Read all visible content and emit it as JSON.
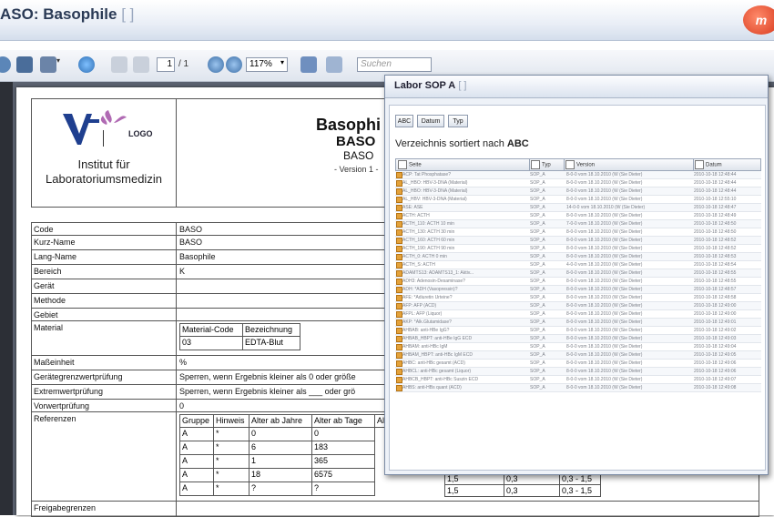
{
  "window": {
    "title": "ASO: Basophile",
    "title_suffix": "[ ]"
  },
  "toolbar": {
    "page_current": "1",
    "page_total": "/ 1",
    "zoom": "117%",
    "search_placeholder": "Suchen"
  },
  "header": {
    "logo_text": "LOGO",
    "institute_line1": "Institut für",
    "institute_line2": "Laboratoriumsmedizin",
    "doc_title": "Basophi",
    "doc_code": "BASO",
    "doc_code2": "BASO",
    "version": "- Version 1 -"
  },
  "fields": [
    {
      "key": "Code",
      "value": "BASO"
    },
    {
      "key": "Kurz-Name",
      "value": "BASO"
    },
    {
      "key": "Lang-Name",
      "value": "Basophile"
    },
    {
      "key": "Bereich",
      "value": "K"
    },
    {
      "key": "Gerät",
      "value": ""
    },
    {
      "key": "Methode",
      "value": ""
    },
    {
      "key": "Gebiet",
      "value": ""
    },
    {
      "key": "Material",
      "value": ""
    },
    {
      "key": "Maßeinheit",
      "value": "%"
    },
    {
      "key": "Gerätegrenzwertprüfung",
      "value": "Sperren, wenn Ergebnis kleiner als 0 oder größe"
    },
    {
      "key": "Extremwertprüfung",
      "value": "Sperren, wenn Ergebnis kleiner als ___ oder grö"
    },
    {
      "key": "Vorwertprüfung",
      "value": "0"
    },
    {
      "key": "Referenzen",
      "value": ""
    },
    {
      "key": "Freigabegrenzen",
      "value": ""
    }
  ],
  "material_table": {
    "headers": [
      "Material-Code",
      "Bezeichnung"
    ],
    "row": [
      "03",
      "EDTA-Blut"
    ]
  },
  "reference_table": {
    "headers": [
      "Gruppe",
      "Hinweis",
      "Alter ab Jahre",
      "Alter ab Tage",
      "Al"
    ],
    "rows": [
      [
        "A",
        "*",
        "0",
        "0",
        ""
      ],
      [
        "A",
        "*",
        "6",
        "183",
        ""
      ],
      [
        "A",
        "*",
        "1",
        "365",
        ""
      ],
      [
        "A",
        "*",
        "18",
        "6575",
        ""
      ],
      [
        "A",
        "*",
        "?",
        "?",
        ""
      ]
    ],
    "extra_rows": [
      [
        "1,5",
        "0,3",
        "0,3 - 1,5"
      ],
      [
        "1,5",
        "0,3",
        "0,3 - 1,5"
      ]
    ]
  },
  "popup": {
    "title": "Labor SOP A",
    "title_suffix": "[ ]",
    "sort_buttons": [
      "ABC",
      "Datum",
      "Typ"
    ],
    "sorted_prefix": "Verzeichnis sortiert nach",
    "sorted_key": "ABC",
    "columns": [
      "Seite",
      "Typ",
      "Version",
      "Datum"
    ],
    "rows": [
      [
        "ACP: Tat Phosphatase?",
        "SOP_A",
        "8-0-0 vom 18.10.2010 (W (Sie Dieter)",
        "2010-10-18 12:48:44"
      ],
      [
        "AL_HBO: HBV-3-DNA (Material)",
        "SOP_A",
        "8-0-0 vom 18.10.2010 (W (Sie Dieter)",
        "2010-10-18 12:48:44"
      ],
      [
        "AL_HBO: HBV-3-DNA (Material)",
        "SOP_A",
        "8-0-0 vom 18.10.2010 (W (Sie Dieter)",
        "2010-10-18 12:48:44"
      ],
      [
        "AL_HBV: HBV-3-DNA (Material)",
        "SOP_A",
        "8-0-0 vom 18.10.2010 (W (Sie Dieter)",
        "2010-10-18 12:55:10"
      ],
      [
        "ASE: ASE",
        "SOP_A",
        "14-0-0 vom 18.10.2010 (W (Sie Dieter)",
        "2010-10-18 12:48:47"
      ],
      [
        "ACTH: ACTH",
        "SOP_A",
        "8-0-0 vom 18.10.2010 (W (Sie Dieter)",
        "2010-10-18 12:48:49"
      ],
      [
        "ACTH_110: ACTH 10 min",
        "SOP_A",
        "7-0-0 vom 18.10.2010 (W (Sie Dieter)",
        "2010-10-18 12:48:50"
      ],
      [
        "ACTH_130: ACTH 30 min",
        "SOP_A",
        "8-0-0 vom 18.10.2010 (W (Sie Dieter)",
        "2010-10-18 12:48:50"
      ],
      [
        "ACTH_160: ACTH 60 min",
        "SOP_A",
        "8-0-0 vom 18.10.2010 (W (Sie Dieter)",
        "2010-10-18 12:48:52"
      ],
      [
        "ACTH_190: ACTH 90 min",
        "SOP_A",
        "8-0-0 vom 18.10.2010 (W (Sie Dieter)",
        "2010-10-18 12:48:52"
      ],
      [
        "ACTH_0: ACTH 0 min",
        "SOP_A",
        "8-0-0 vom 18.10.2010 (W (Sie Dieter)",
        "2010-10-18 12:48:53"
      ],
      [
        "ACTH_S: ACTH",
        "SOP_A",
        "4-0-0 vom 18.10.2010 (W (Sie Dieter)",
        "2010-10-18 12:48:54"
      ],
      [
        "ADAMTS13: ADAMTS13_1: Aktiv...",
        "SOP_A",
        "8-0-0 vom 18.10.2010 (W (Sie Dieter)",
        "2010-10-18 12:48:55"
      ],
      [
        "ADH3: Adenosin-Desaminase?",
        "SOP_A",
        "8-0-0 vom 18.10.2010 (W (Sie Dieter)",
        "2010-10-18 12:48:55"
      ],
      [
        "ADH: *ADH (Vasopressin)?",
        "SOP_A",
        "8-0-0 vom 18.10.2010 (W (Sie Dieter)",
        "2010-10-18 12:48:57"
      ],
      [
        "AFE: *Adiuretin Urteine?",
        "SOP_A",
        "8-0-0 vom 18.10.2010 (W (Sie Dieter)",
        "2010-10-18 12:48:58"
      ],
      [
        "AFP: AFP (ACD)",
        "SOP_A",
        "8-0-0 vom 18.10.2010 (W (Sie Dieter)",
        "2010-10-18 12:49:00"
      ],
      [
        "AFPL: AFP (Liquor)",
        "SOP_A",
        "8-0-0 vom 18.10.2010 (W (Sie Dieter)",
        "2010-10-18 12:49:00"
      ],
      [
        "AKP: *Alk.Glutamidase?",
        "SOP_A",
        "8-0-0 vom 18.10.2010 (W (Sie Dieter)",
        "2010-10-18 12:49:01"
      ],
      [
        "AHBAB: anti-HBe IgG?",
        "SOP_A",
        "8-0-0 vom 18.10.2010 (W (Sie Dieter)",
        "2010-10-18 12:49:02"
      ],
      [
        "AHBAB_HBPT: anti-HBe IgG ECD",
        "SOP_A",
        "8-0-0 vom 18.10.2010 (W (Sie Dieter)",
        "2010-10-18 12:49:03"
      ],
      [
        "AHBAM: anti-HBc IgM",
        "SOP_A",
        "8-0-0 vom 18.10.2010 (W (Sie Dieter)",
        "2010-10-18 12:49:04"
      ],
      [
        "AHBAM_HBPT: anti-HBc IgM ECD",
        "SOP_A",
        "8-0-0 vom 18.10.2010 (W (Sie Dieter)",
        "2010-10-18 12:49:05"
      ],
      [
        "AHBC: anti-HBc gesamt (ACD)",
        "SOP_A",
        "8-0-0 vom 18.10.2010 (W (Sie Dieter)",
        "2010-10-18 12:49:06"
      ],
      [
        "AHBCL: anti-HBc gesamt (Liquor)",
        "SOP_A",
        "8-0-0 vom 18.10.2010 (W (Sie Dieter)",
        "2010-10-18 12:49:06"
      ],
      [
        "AHBCB_HBPT: anti-HBc Suszin ECD",
        "SOP_A",
        "8-0-0 vom 18.10.2010 (W (Sie Dieter)",
        "2010-10-18 12:49:07"
      ],
      [
        "AHBS: anti-HBs quant (ACD)",
        "SOP_A",
        "8-0-0 vom 18.10.2010 (W (Sie Dieter)",
        "2010-10-18 12:49:08"
      ]
    ]
  },
  "colors": {
    "title_text": "#2a3a55",
    "popup_border": "#7a8aa4",
    "doc_background": "#5b6270",
    "watermark": "#f5c7c7"
  }
}
